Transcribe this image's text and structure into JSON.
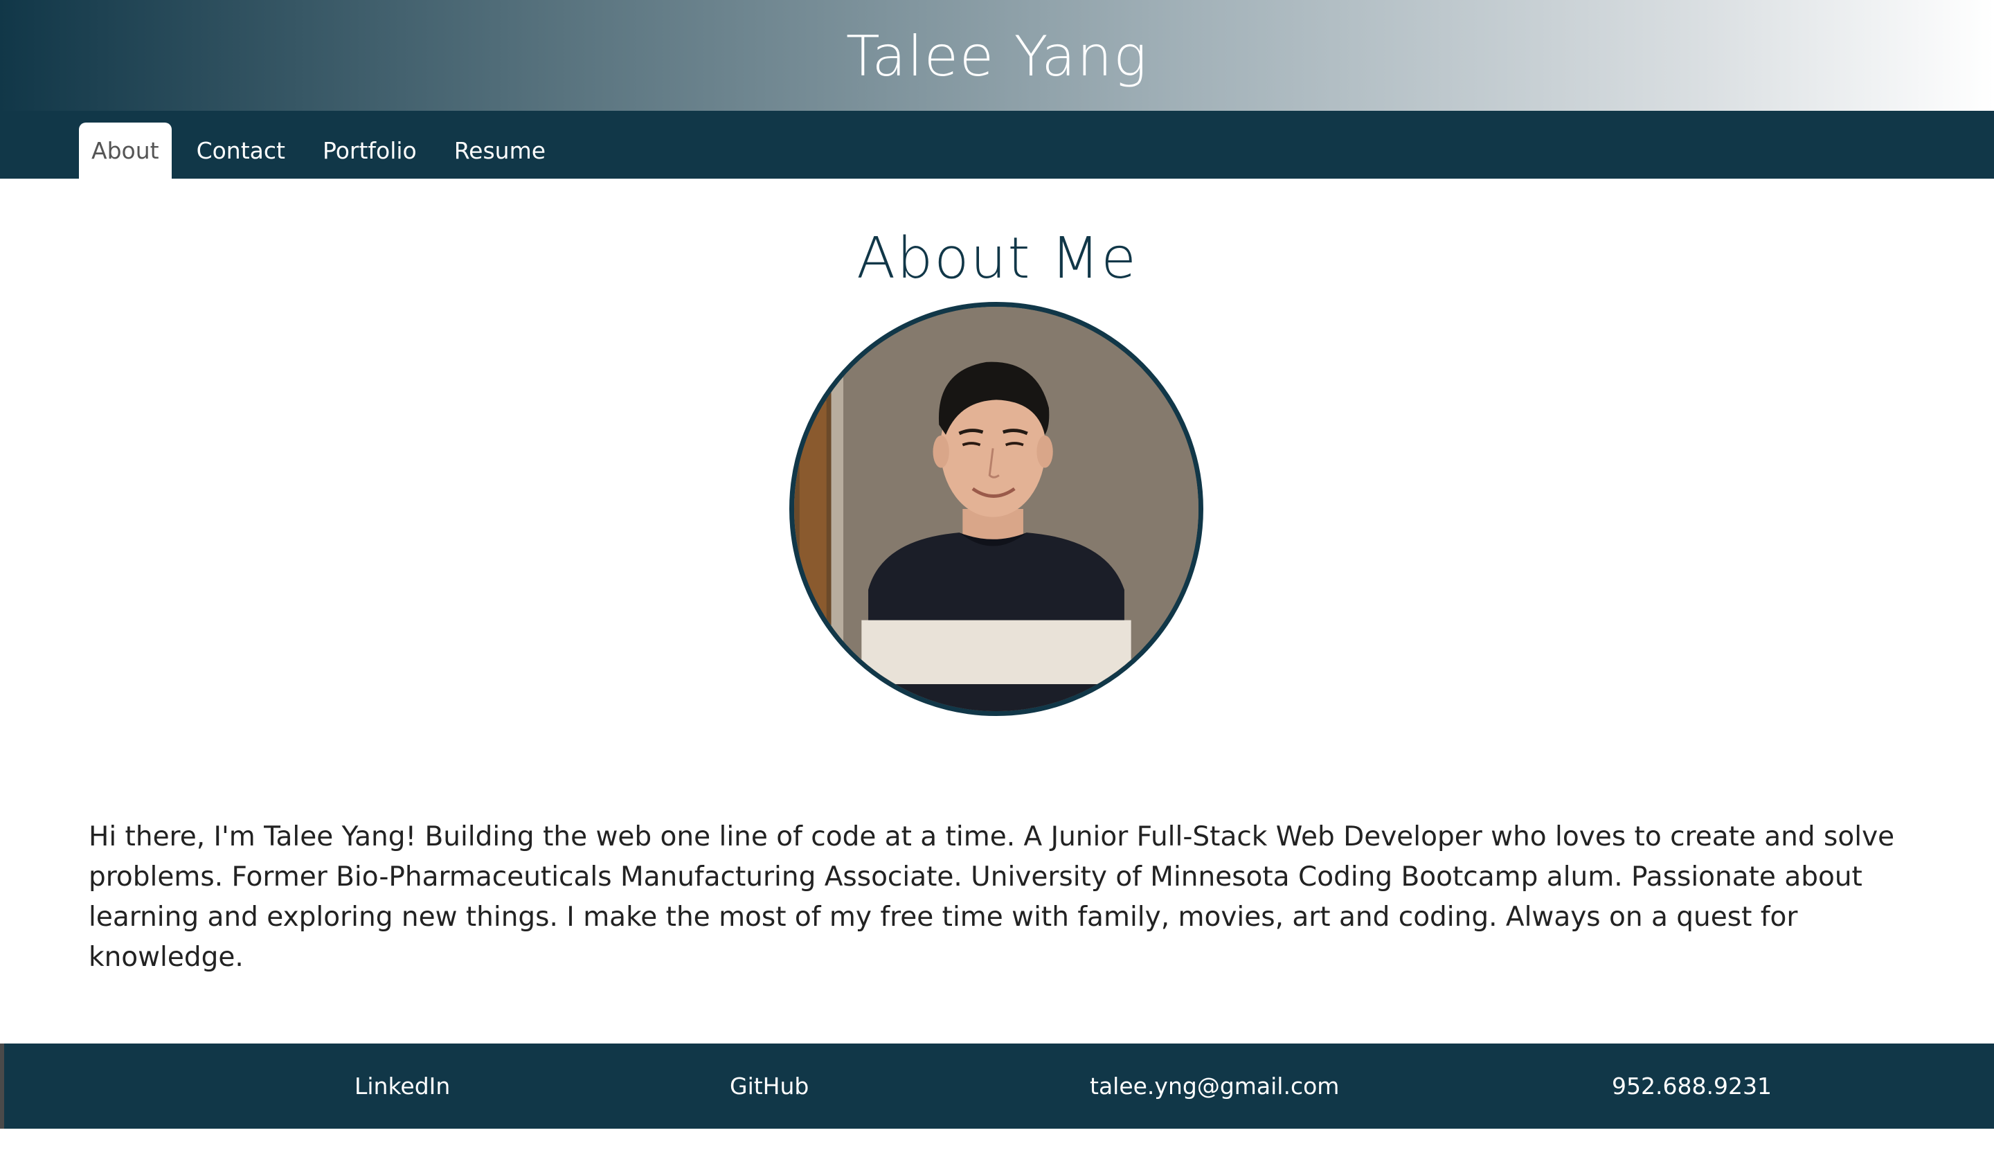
{
  "header": {
    "title": "Talee Yang"
  },
  "nav": {
    "tabs": [
      {
        "label": "About",
        "active": true
      },
      {
        "label": "Contact",
        "active": false
      },
      {
        "label": "Portfolio",
        "active": false
      },
      {
        "label": "Resume",
        "active": false
      }
    ]
  },
  "main": {
    "heading": "About Me",
    "portrait_icon": "profile-photo",
    "bio": "Hi there, I'm Talee Yang! Building the web one line of code at a time. A Junior Full-Stack Web Developer who loves to create and solve problems. Former Bio-Pharmaceuticals Manufacturing Associate. University of Minnesota Coding Bootcamp alum. Passionate about learning and exploring new things. I make the most of my free time with family, movies, art and coding. Always on a quest for knowledge."
  },
  "footer": {
    "links": [
      {
        "label": "LinkedIn"
      },
      {
        "label": "GitHub"
      },
      {
        "label": "talee.yng@gmail.com"
      },
      {
        "label": "952.688.9231"
      }
    ]
  },
  "colors": {
    "primary": "#113748",
    "white": "#ffffff",
    "text": "#222222"
  }
}
